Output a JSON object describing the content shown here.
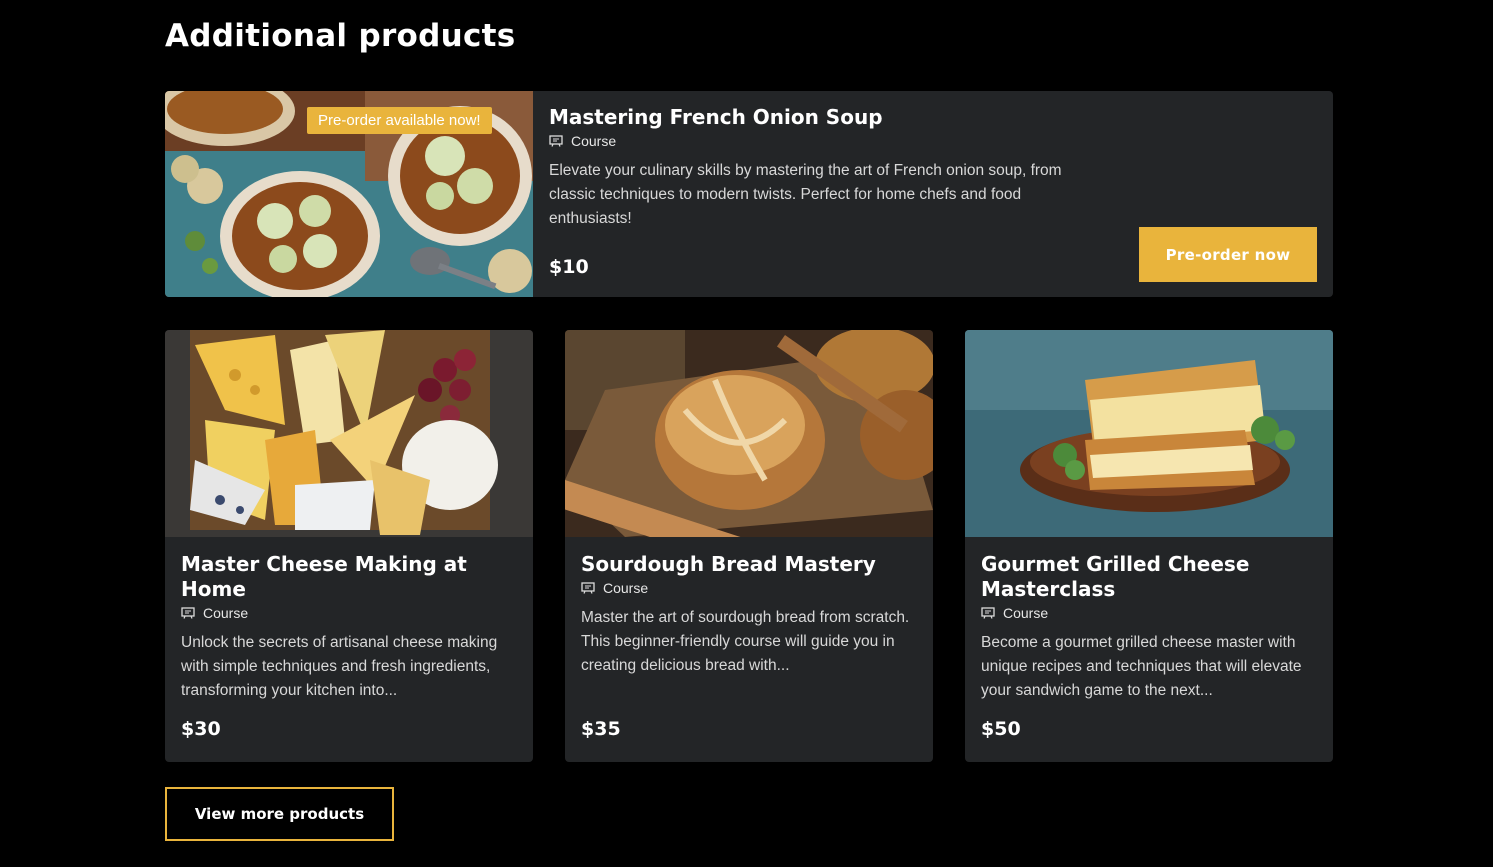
{
  "section": {
    "title": "Additional products"
  },
  "featured": {
    "badge": "Pre-order available now!",
    "title": "Mastering French Onion Soup",
    "type": "Course",
    "description": "Elevate your culinary skills by mastering the art of French onion soup, from classic techniques to modern twists. Perfect for home chefs and food enthusiasts!",
    "price": "$10",
    "button_label": "Pre-order now",
    "image_icon": "soup-photo"
  },
  "products": [
    {
      "title": "Master Cheese Making at Home",
      "type": "Course",
      "description": "Unlock the secrets of artisanal cheese making with simple techniques and fresh ingredients, transforming your kitchen into...",
      "price": "$30",
      "image_icon": "cheese-board-photo"
    },
    {
      "title": "Sourdough Bread Mastery",
      "type": "Course",
      "description": "Master the art of sourdough bread from scratch. This beginner-friendly course will guide you in creating delicious bread with...",
      "price": "$35",
      "image_icon": "bread-photo"
    },
    {
      "title": "Gourmet Grilled Cheese Masterclass",
      "type": "Course",
      "description": "Become a gourmet grilled cheese master with unique recipes and techniques that will elevate your sandwich game to the next...",
      "price": "$50",
      "image_icon": "grilled-cheese-photo"
    }
  ],
  "view_more_label": "View more products",
  "colors": {
    "accent": "#e9b43c",
    "card_bg": "#232527",
    "page_bg": "#000000"
  }
}
